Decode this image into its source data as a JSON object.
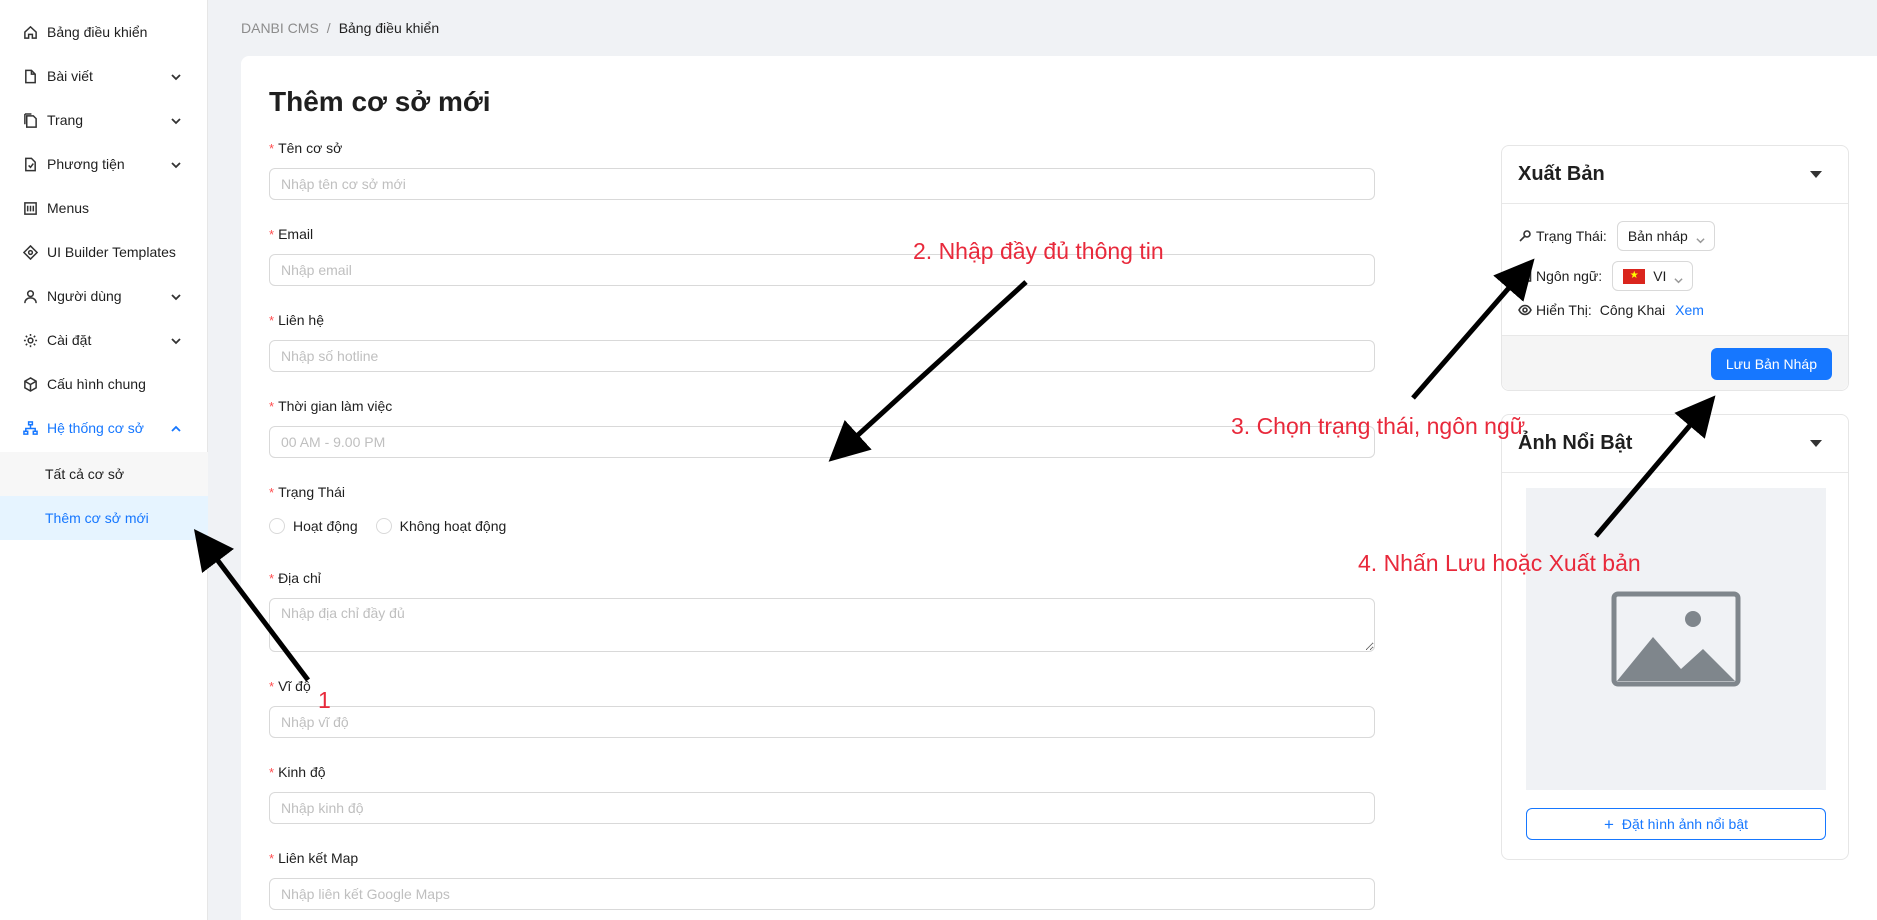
{
  "sidebar": {
    "items": [
      {
        "label": "Bảng điều khiển",
        "icon": "home-icon",
        "has_children": false
      },
      {
        "label": "Bài viết",
        "icon": "file-icon",
        "has_children": true
      },
      {
        "label": "Trang",
        "icon": "pages-icon",
        "has_children": true
      },
      {
        "label": "Phương tiện",
        "icon": "media-icon",
        "has_children": true
      },
      {
        "label": "Menus",
        "icon": "menu-icon",
        "has_children": false
      },
      {
        "label": "UI Builder Templates",
        "icon": "builder-icon",
        "has_children": false
      },
      {
        "label": "Người dùng",
        "icon": "user-icon",
        "has_children": true
      },
      {
        "label": "Cài đặt",
        "icon": "gear-icon",
        "has_children": true
      },
      {
        "label": "Cấu hình chung",
        "icon": "config-icon",
        "has_children": false
      },
      {
        "label": "Hệ thống cơ sở",
        "icon": "sitemap-icon",
        "has_children": true,
        "expanded": true
      }
    ],
    "subitems": [
      {
        "label": "Tất cả cơ sở"
      },
      {
        "label": "Thêm cơ sở mới",
        "selected": true
      }
    ]
  },
  "breadcrumb": {
    "root": "DANBI CMS",
    "separator": "/",
    "current": "Bảng điều khiển"
  },
  "form": {
    "title": "Thêm cơ sở mới",
    "fields": {
      "name": {
        "label": "Tên cơ sở",
        "placeholder": "Nhập tên cơ sở mới"
      },
      "email": {
        "label": "Email",
        "placeholder": "Nhập email"
      },
      "contact": {
        "label": "Liên hệ",
        "placeholder": "Nhập số hotline"
      },
      "hours": {
        "label": "Thời gian làm việc",
        "placeholder": "00 AM - 9.00 PM"
      },
      "status": {
        "label": "Trạng Thái",
        "options": [
          "Hoạt động",
          "Không hoạt động"
        ]
      },
      "address": {
        "label": "Địa chỉ",
        "placeholder": "Nhập địa chỉ đầy đủ"
      },
      "latitude": {
        "label": "Vĩ độ",
        "placeholder": "Nhập vĩ độ"
      },
      "longitude": {
        "label": "Kinh độ",
        "placeholder": "Nhập kinh độ"
      },
      "map_link": {
        "label": "Liên kết Map",
        "placeholder": "Nhập liên kết Google Maps"
      }
    }
  },
  "publish_panel": {
    "title": "Xuất Bản",
    "status_label": "Trạng Thái:",
    "status_value": "Bản nháp",
    "language_label": "Ngôn ngữ:",
    "language_value": "VI",
    "visibility_label": "Hiển Thị:",
    "visibility_value": "Công Khai",
    "view_link": "Xem",
    "save_button": "Lưu Bản Nháp"
  },
  "featured_panel": {
    "title": "Ảnh Nổi Bật",
    "set_button": "Đặt hình ảnh nổi bật"
  },
  "annotations": {
    "step1": "1",
    "step2": "2. Nhập đầy đủ thông tin",
    "step3": "3. Chọn trạng thái, ngôn ngữ",
    "step4": "4. Nhấn Lưu hoặc Xuất bản"
  },
  "colors": {
    "accent": "#1677ff",
    "annotation": "#e8293b",
    "required": "#ff4d4f"
  }
}
